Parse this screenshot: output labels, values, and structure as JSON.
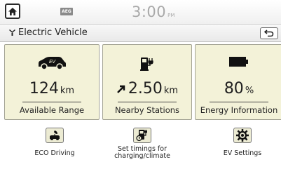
{
  "status_bar": {
    "badge": "AEG",
    "time": "3:00",
    "ampm": "PM"
  },
  "title_bar": {
    "title": "Electric Vehicle"
  },
  "tiles": [
    {
      "value": "124",
      "unit": "km",
      "label": "Available Range",
      "icon": "ev-car-icon"
    },
    {
      "value": "2.50",
      "unit": "km",
      "label": "Nearby Stations",
      "icon": "charging-station-icon"
    },
    {
      "value": "80",
      "unit": "%",
      "label": "Energy Information",
      "icon": "battery-icon"
    }
  ],
  "bottom_menu": [
    {
      "label": "ECO Driving",
      "icon": "eco-driving-icon"
    },
    {
      "label": "Set timings for charging/climate",
      "icon": "charging-timer-icon"
    },
    {
      "label": "EV Settings",
      "icon": "gear-icon"
    }
  ],
  "colors": {
    "tile_background": "#f3f2d8",
    "tile_border": "#a3a394"
  }
}
